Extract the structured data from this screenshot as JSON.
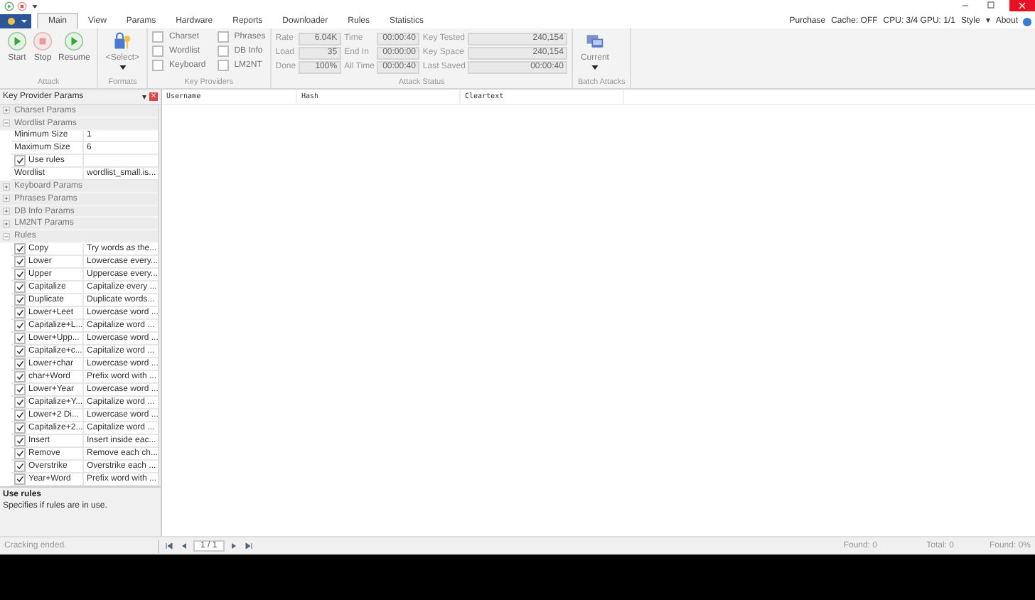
{
  "tabs": [
    {
      "label": "Main",
      "selected": true
    },
    {
      "label": "View",
      "selected": false
    },
    {
      "label": "Params",
      "selected": false
    },
    {
      "label": "Hardware",
      "selected": false
    },
    {
      "label": "Reports",
      "selected": false
    },
    {
      "label": "Downloader",
      "selected": false
    },
    {
      "label": "Rules",
      "selected": false
    },
    {
      "label": "Statistics",
      "selected": false
    }
  ],
  "top_right": {
    "purchase": "Purchase",
    "cache": "Cache: OFF",
    "hardware": "CPU: 3/4 GPU: 1/1",
    "style": "Style",
    "style_arrow": "▾",
    "about": "About"
  },
  "ribbon": {
    "attack": {
      "label": "Attack",
      "buttons": [
        {
          "label": "Start",
          "kind": "play",
          "disabled": false
        },
        {
          "label": "Stop",
          "kind": "stop",
          "disabled": false
        },
        {
          "label": "Resume",
          "kind": "play",
          "disabled": false
        }
      ]
    },
    "formats": {
      "label": "Formats",
      "button": "<Select>"
    },
    "key_providers": {
      "label": "Key Providers",
      "items": [
        {
          "label": "Charset",
          "checked": false
        },
        {
          "label": "Wordlist",
          "checked": false
        },
        {
          "label": "Keyboard",
          "checked": false
        },
        {
          "label": "Phrases",
          "checked": false
        },
        {
          "label": "DB Info",
          "checked": false
        },
        {
          "label": "LM2NT",
          "checked": false
        }
      ]
    },
    "attack_status": {
      "label": "Attack Status",
      "fields": [
        {
          "label": "Rate",
          "value": "6.04K"
        },
        {
          "label": "Time",
          "value": "00:00:40"
        },
        {
          "label": "Key Tested",
          "value": "240,154"
        },
        {
          "label": "Load",
          "value": "35"
        },
        {
          "label": "End In",
          "value": "00:00:00"
        },
        {
          "label": "Key Space",
          "value": "240,154"
        },
        {
          "label": "Done",
          "value": "100%"
        },
        {
          "label": "All Time",
          "value": "00:00:40"
        },
        {
          "label": "Last Saved",
          "value": "00:00:40"
        }
      ]
    },
    "batch_attacks": {
      "label": "Batch Attacks",
      "button": "Current"
    }
  },
  "panel": {
    "title": "Key Provider Params",
    "pin": "▾",
    "close": "×",
    "sections": [
      {
        "title": "Charset Params",
        "expanded": false
      },
      {
        "title": "Wordlist Params",
        "expanded": true,
        "rows": [
          {
            "kind": "text",
            "name": "Minimum Size",
            "value": "1"
          },
          {
            "kind": "text",
            "name": "Maximum Size",
            "value": "6"
          },
          {
            "kind": "check",
            "name": "Use rules",
            "checked": true
          },
          {
            "kind": "text",
            "name": "Wordlist",
            "value": "wordlist_small.is..."
          }
        ]
      },
      {
        "title": "Keyboard Params",
        "expanded": false
      },
      {
        "title": "Phrases Params",
        "expanded": false
      },
      {
        "title": "DB Info Params",
        "expanded": false
      },
      {
        "title": "LM2NT Params",
        "expanded": false
      },
      {
        "title": "Rules",
        "expanded": true,
        "rows": [
          {
            "kind": "rule",
            "name": "Copy",
            "value": "Try words as the...",
            "checked": true
          },
          {
            "kind": "rule",
            "name": "Lower",
            "value": "Lowercase every...",
            "checked": true
          },
          {
            "kind": "rule",
            "name": "Upper",
            "value": "Uppercase every...",
            "checked": true
          },
          {
            "kind": "rule",
            "name": "Capitalize",
            "value": "Capitalize every ...",
            "checked": true
          },
          {
            "kind": "rule",
            "name": "Duplicate",
            "value": "Duplicate words...",
            "checked": true
          },
          {
            "kind": "rule",
            "name": "Lower+Leet",
            "value": "Lowercase word ...",
            "checked": true
          },
          {
            "kind": "rule",
            "name": "Capitalize+L...",
            "value": "Capitalize word ...",
            "checked": true
          },
          {
            "kind": "rule",
            "name": "Lower+Upp...",
            "value": "Lowercase word ...",
            "checked": true
          },
          {
            "kind": "rule",
            "name": "Capitalize+c...",
            "value": "Capitalize word ...",
            "checked": true
          },
          {
            "kind": "rule",
            "name": "Lower+char",
            "value": "Lowercase word ...",
            "checked": true
          },
          {
            "kind": "rule",
            "name": "char+Word",
            "value": "Prefix word with ...",
            "checked": true
          },
          {
            "kind": "rule",
            "name": "Lower+Year",
            "value": "Lowercase word ...",
            "checked": true
          },
          {
            "kind": "rule",
            "name": "Capitalize+Y...",
            "value": "Capitalize word ...",
            "checked": true
          },
          {
            "kind": "rule",
            "name": "Lower+2 Di...",
            "value": "Lowercase word ...",
            "checked": true
          },
          {
            "kind": "rule",
            "name": "Capitalize+2...",
            "value": "Capitalize word ...",
            "checked": true
          },
          {
            "kind": "rule",
            "name": "Insert",
            "value": "Insert inside eac...",
            "checked": true
          },
          {
            "kind": "rule",
            "name": "Remove",
            "value": "Remove each ch...",
            "checked": true
          },
          {
            "kind": "rule",
            "name": "Overstrike",
            "value": "Overstrike each ...",
            "checked": true
          },
          {
            "kind": "rule",
            "name": "Year+Word",
            "value": "Prefix word with ...",
            "checked": true
          }
        ]
      }
    ],
    "description": {
      "title": "Use rules",
      "text": "Specifies if rules are in use."
    }
  },
  "table": {
    "columns": [
      "Username",
      "Hash",
      "Cleartext"
    ]
  },
  "status_bar": {
    "message": "Cracking ended.",
    "page": "1 / 1",
    "found": "Found: 0",
    "total": "Total: 0",
    "found_percent": "Found: 0%"
  }
}
